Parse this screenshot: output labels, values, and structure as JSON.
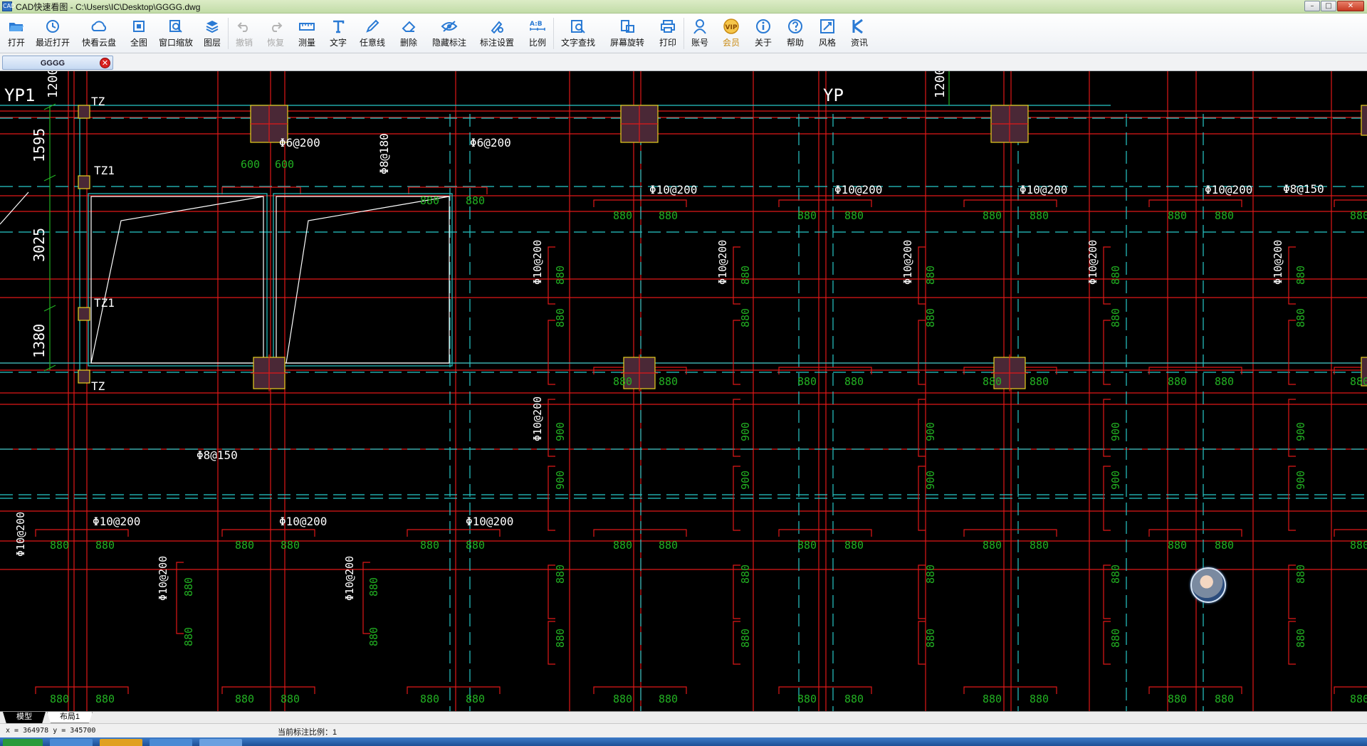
{
  "window": {
    "title": "CAD快速看图 - C:\\Users\\IC\\Desktop\\GGGG.dwg",
    "app_icon_text": "CAD"
  },
  "toolbar": {
    "items": [
      {
        "label": "打开",
        "icon": "folder-open-icon",
        "enabled": true
      },
      {
        "label": "最近打开",
        "icon": "history-icon",
        "enabled": true
      },
      {
        "label": "快看云盘",
        "icon": "cloud-icon",
        "enabled": true
      },
      {
        "label": "全图",
        "icon": "fit-all-icon",
        "enabled": true
      },
      {
        "label": "窗口缩放",
        "icon": "zoom-window-icon",
        "enabled": true
      },
      {
        "label": "图层",
        "icon": "layers-icon",
        "enabled": true
      },
      {
        "label": "撤销",
        "icon": "undo-icon",
        "enabled": false
      },
      {
        "label": "恢复",
        "icon": "redo-icon",
        "enabled": false
      },
      {
        "label": "测量",
        "icon": "ruler-icon",
        "enabled": true
      },
      {
        "label": "文字",
        "icon": "text-icon",
        "enabled": true
      },
      {
        "label": "任意线",
        "icon": "pen-icon",
        "enabled": true
      },
      {
        "label": "删除",
        "icon": "eraser-icon",
        "enabled": true
      },
      {
        "label": "隐藏标注",
        "icon": "eye-hide-icon",
        "enabled": true
      },
      {
        "label": "标注设置",
        "icon": "annotation-settings-icon",
        "enabled": true
      },
      {
        "label": "比例",
        "icon": "scale-icon",
        "enabled": true
      },
      {
        "label": "文字查找",
        "icon": "text-search-icon",
        "enabled": true
      },
      {
        "label": "屏幕旋转",
        "icon": "rotate-screen-icon",
        "enabled": true
      },
      {
        "label": "打印",
        "icon": "printer-icon",
        "enabled": true
      },
      {
        "label": "账号",
        "icon": "user-icon",
        "enabled": true
      },
      {
        "label": "会员",
        "icon": "vip-icon",
        "enabled": true
      },
      {
        "label": "关于",
        "icon": "info-icon",
        "enabled": true
      },
      {
        "label": "帮助",
        "icon": "help-icon",
        "enabled": true
      },
      {
        "label": "风格",
        "icon": "style-icon",
        "enabled": true
      },
      {
        "label": "资讯",
        "icon": "news-icon",
        "enabled": true
      }
    ],
    "vip_badge": "VIP"
  },
  "tabs": {
    "document": "GGGG",
    "close_glyph": "✕"
  },
  "window_controls": {
    "minimize": "–",
    "maximize": "□",
    "close": "✕"
  },
  "drawing": {
    "labels": {
      "yp1": "YP1",
      "yp": "YP",
      "dim_1200": "1200",
      "dim_1595": "1595",
      "dim_3025": "3025",
      "dim_1380": "1380",
      "tz": "TZ",
      "tz1": "TZ1",
      "r6_200": "Φ6@200",
      "r8_180": "Φ8@180",
      "r10_200": "Φ10@200",
      "r8_150": "Φ8@150",
      "n600": "600",
      "n880": "880",
      "n900": "900"
    },
    "colors": {
      "grid_red": "#e01818",
      "cyan": "#27c9c9",
      "green": "#22b022",
      "yellow": "#e8d020",
      "column_fill": "#4a2836",
      "white": "#ffffff"
    }
  },
  "layout_tabs": {
    "model": "模型",
    "layout1": "布局1"
  },
  "status": {
    "coords": "x = 364978  y = 345700",
    "scale_text": "当前标注比例：1"
  }
}
